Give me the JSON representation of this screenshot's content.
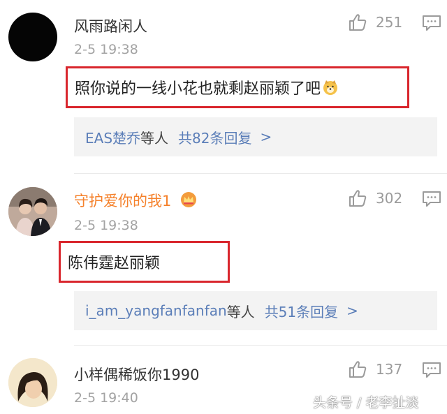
{
  "comments": [
    {
      "username": "风雨路闲人",
      "time": "2-5 19:38",
      "likes": "251",
      "content": "照你说的一线小花也就剩赵丽颖了吧",
      "content_emoji": "doge-emoji",
      "reply_preview": {
        "user": "EAS楚乔",
        "etc": "等人",
        "count_text": "共82条回复",
        "arrow": ">"
      }
    },
    {
      "username": "守护爱你的我1",
      "username_badge": "crown-icon",
      "time": "2-5 19:38",
      "likes": "302",
      "content": "陈伟霆赵丽颖",
      "reply_preview": {
        "user": "i_am_yangfanfanfan",
        "etc": "等人",
        "count_text": "共51条回复",
        "arrow": ">"
      }
    },
    {
      "username": "小样偶稀饭你1990",
      "time": "2-5 19:40",
      "likes": "137"
    }
  ],
  "watermark": "头条号 / 老李扯淡",
  "colors": {
    "highlight_border": "#d9262d",
    "link": "#5b7eb8",
    "vip_name": "#f5812b",
    "meta": "#a3a3a3"
  }
}
